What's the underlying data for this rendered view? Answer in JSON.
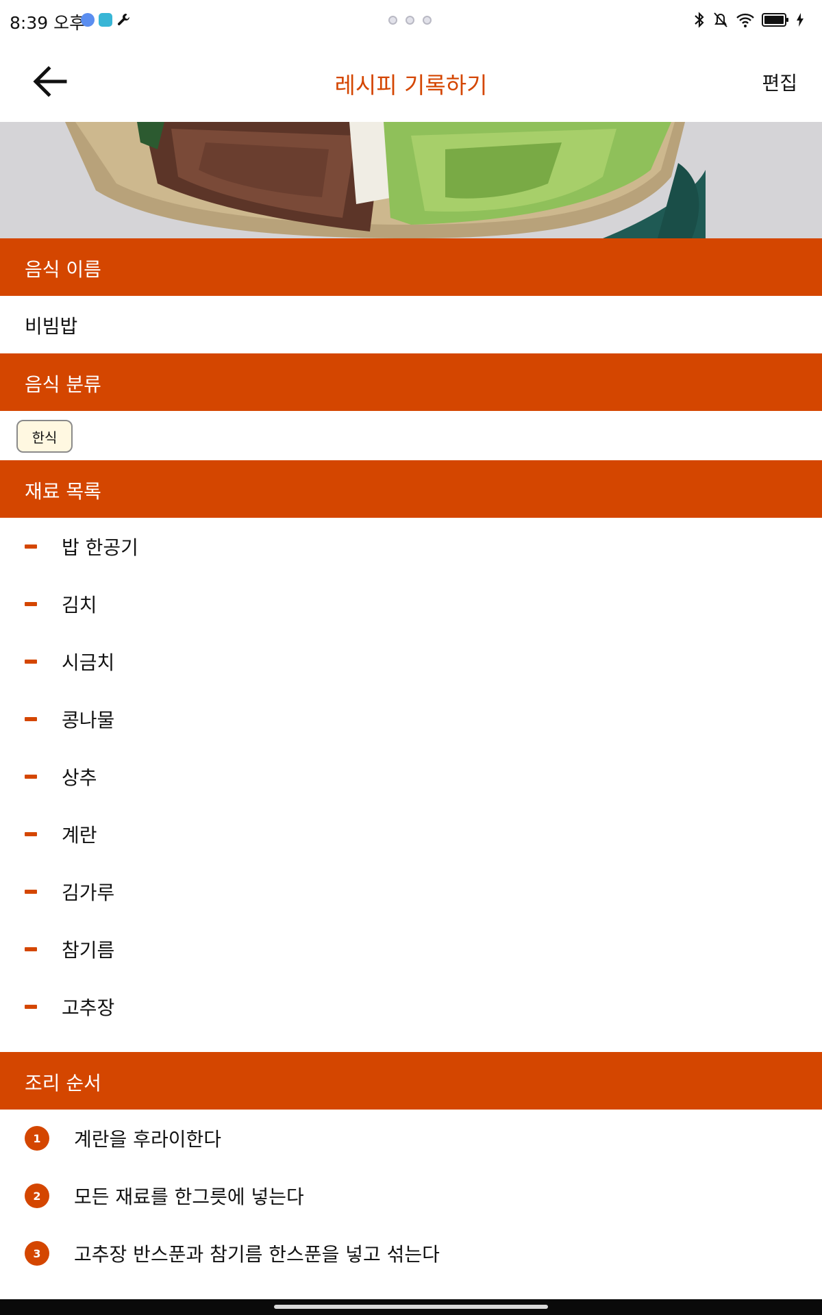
{
  "status_bar": {
    "time": "8:39 오후"
  },
  "app_bar": {
    "title": "레시피 기록하기",
    "edit_label": "편집"
  },
  "sections": {
    "food_name_header": "음식 이름",
    "category_header": "음식 분류",
    "ingredients_header": "재료 목록",
    "steps_header": "조리 순서"
  },
  "recipe": {
    "food_name": "비빔밥",
    "category": "한식",
    "ingredients": [
      "밥 한공기",
      "김치",
      "시금치",
      "콩나물",
      "상추",
      "계란",
      "김가루",
      "참기름",
      "고추장"
    ],
    "steps": [
      {
        "number": "1",
        "text": "계란을 후라이한다"
      },
      {
        "number": "2",
        "text": "모든 재료를 한그릇에 넣는다"
      },
      {
        "number": "3",
        "text": "고추장 반스푼과 참기름 한스푼을 넣고 섞는다"
      }
    ]
  },
  "colors": {
    "accent": "#d44600",
    "chip_background": "#fff8e1"
  }
}
